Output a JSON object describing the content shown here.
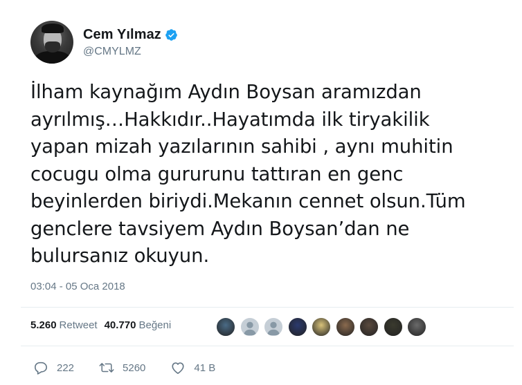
{
  "author": {
    "name": "Cem Yılmaz",
    "handle": "@CMYLMZ",
    "verified_icon": "verified-badge-icon",
    "verified_color": "#1da1f2"
  },
  "tweet": {
    "text": "İlham kaynağım Aydın Boysan aramızdan\nayrılmış…Hakkıdır..Hayatımda ilk tiryakilik\nyapan mizah yazılarının sahibi , aynı muhitin\ncocugu olma gururunu tattıran en genc\nbeyinlerden biriydi.Mekanın cennet olsun.Tüm\ngenclere tavsiyem Aydın Boysan’dan ne\nbulursanız okuyun.",
    "timestamp": "03:04 - 05 Oca 2018"
  },
  "stats": {
    "retweet_count": "5.260",
    "retweet_label": "Retweet",
    "like_count": "40.770",
    "like_label": "Beğeni"
  },
  "likers": [
    {
      "icon": "liker-avatar-icon",
      "color": "#4a6b86"
    },
    {
      "icon": "default-avatar-icon",
      "color": "#c5ced6"
    },
    {
      "icon": "default-avatar-icon",
      "color": "#c5ced6"
    },
    {
      "icon": "liker-avatar-icon",
      "color": "#2b3a6e"
    },
    {
      "icon": "liker-avatar-icon",
      "color": "#d8c27a"
    },
    {
      "icon": "liker-avatar-icon",
      "color": "#8a6a4e"
    },
    {
      "icon": "liker-avatar-icon",
      "color": "#5a4a3e"
    },
    {
      "icon": "liker-avatar-icon",
      "color": "#3a3a2e"
    },
    {
      "icon": "liker-avatar-icon",
      "color": "#6a6a6a"
    }
  ],
  "actions": {
    "reply_count": "222",
    "retweet_count": "5260",
    "like_count": "41 B"
  },
  "colors": {
    "text": "#14171a",
    "secondary": "#657786",
    "divider": "#e6ecf0"
  }
}
